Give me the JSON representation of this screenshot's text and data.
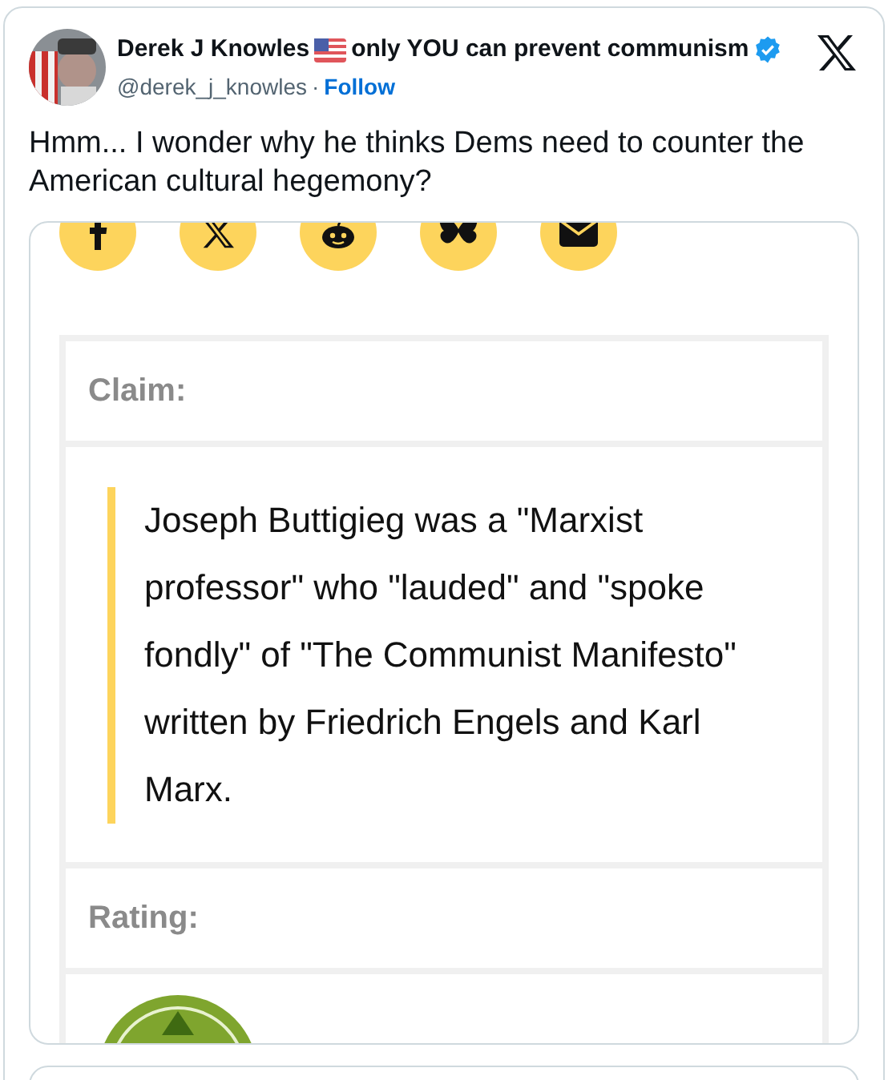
{
  "author": {
    "name": "Derek J Knowles",
    "name_suffix": "only YOU can prevent communism",
    "handle": "@derek_j_knowles",
    "separator": "·",
    "follow": "Follow"
  },
  "tweet_text": "Hmm... I wonder why he thinks Dems need to counter the American cultural hegemony?",
  "media": {
    "claim_heading": "Claim:",
    "claim_text": "Joseph Buttigieg was a \"Marxist professor\" who \"lauded\" and \"spoke fondly\" of \"The Communist Manifesto\" written by Friedrich Engels and Karl Marx.",
    "rating_heading": "Rating:"
  }
}
